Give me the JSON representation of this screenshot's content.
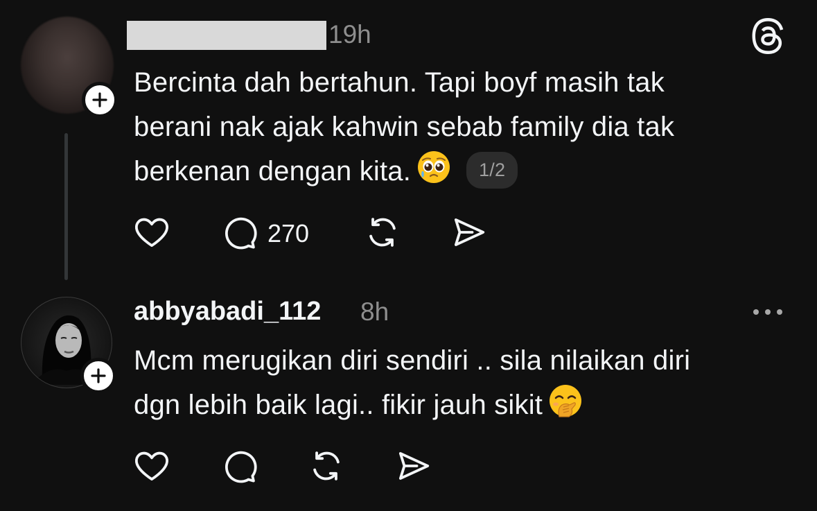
{
  "post1": {
    "time": "19h",
    "text_lines": [
      "Bercinta dah bertahun. Tapi boyf masih tak",
      "berani nak ajak kahwin sebab family dia tak",
      "berkenan dengan kita."
    ],
    "emoji": "pleading-face-with-tear",
    "thread_counter": "1/2",
    "reply_count": "270",
    "actions": [
      "heart-icon",
      "comment-icon",
      "repost-icon",
      "share-icon"
    ]
  },
  "post2": {
    "username": "abbyabadi_112",
    "time": "8h",
    "text_lines": [
      "Mcm merugikan diri sendiri .. sila nilaikan diri",
      "dgn lebih baik lagi.. fikir jauh sikit"
    ],
    "emoji": "hand-over-mouth-face",
    "actions": [
      "heart-icon",
      "comment-icon",
      "repost-icon",
      "share-icon"
    ]
  },
  "icons": {
    "app_logo": "threads-logo-icon",
    "more": "more-horizontal-icon",
    "follow": "plus-icon"
  },
  "colors": {
    "background": "#101010",
    "text": "#f3f5f7",
    "muted": "#8e8e8e",
    "pill_bg": "#2c2c2c"
  }
}
